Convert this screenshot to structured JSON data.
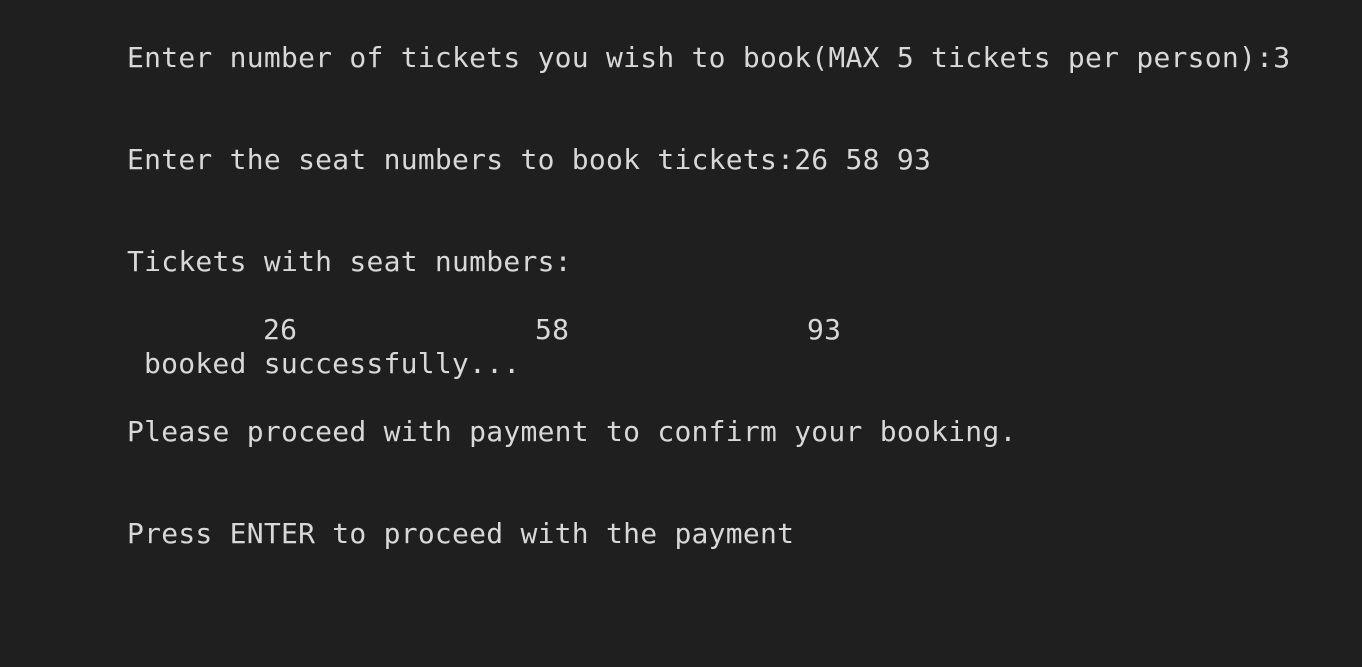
{
  "terminal": {
    "lines": {
      "tickets_prompt": "Enter number of tickets you wish to book(MAX 5 tickets per person):3",
      "seats_prompt": "Enter the seat numbers to book tickets:26 58 93",
      "tickets_header": "Tickets with seat numbers:",
      "seat_numbers": [
        "26",
        "58",
        "93"
      ],
      "booked_message": "booked successfully...",
      "payment_notice": "Please proceed with payment to confirm your booking.",
      "enter_prompt": "Press ENTER to proceed with the payment"
    },
    "colors": {
      "background": "#1f1f1f",
      "text": "#d8d8d8"
    }
  }
}
